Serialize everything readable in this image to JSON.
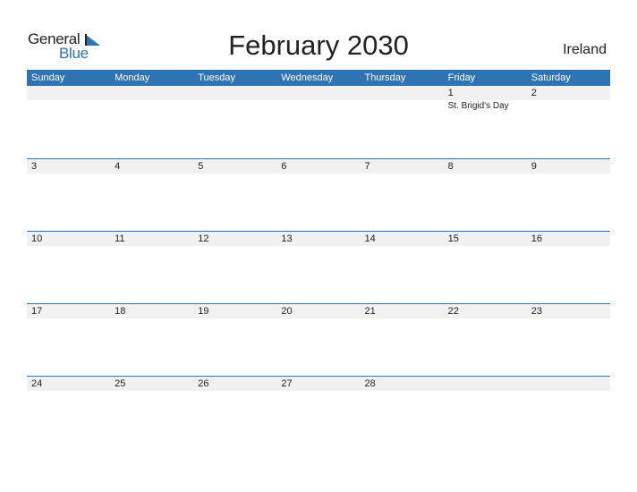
{
  "logo": {
    "line1": "General",
    "line2": "Blue"
  },
  "title": "February 2030",
  "country": "Ireland",
  "colors": {
    "accent": "#2e74b5",
    "strip": "#f1f1f1"
  },
  "weekdays": [
    "Sunday",
    "Monday",
    "Tuesday",
    "Wednesday",
    "Thursday",
    "Friday",
    "Saturday"
  ],
  "weeks": [
    [
      {
        "d": "",
        "h": ""
      },
      {
        "d": "",
        "h": ""
      },
      {
        "d": "",
        "h": ""
      },
      {
        "d": "",
        "h": ""
      },
      {
        "d": "",
        "h": ""
      },
      {
        "d": "1",
        "h": "St. Brigid's Day"
      },
      {
        "d": "2",
        "h": ""
      }
    ],
    [
      {
        "d": "3",
        "h": ""
      },
      {
        "d": "4",
        "h": ""
      },
      {
        "d": "5",
        "h": ""
      },
      {
        "d": "6",
        "h": ""
      },
      {
        "d": "7",
        "h": ""
      },
      {
        "d": "8",
        "h": ""
      },
      {
        "d": "9",
        "h": ""
      }
    ],
    [
      {
        "d": "10",
        "h": ""
      },
      {
        "d": "11",
        "h": ""
      },
      {
        "d": "12",
        "h": ""
      },
      {
        "d": "13",
        "h": ""
      },
      {
        "d": "14",
        "h": ""
      },
      {
        "d": "15",
        "h": ""
      },
      {
        "d": "16",
        "h": ""
      }
    ],
    [
      {
        "d": "17",
        "h": ""
      },
      {
        "d": "18",
        "h": ""
      },
      {
        "d": "19",
        "h": ""
      },
      {
        "d": "20",
        "h": ""
      },
      {
        "d": "21",
        "h": ""
      },
      {
        "d": "22",
        "h": ""
      },
      {
        "d": "23",
        "h": ""
      }
    ],
    [
      {
        "d": "24",
        "h": ""
      },
      {
        "d": "25",
        "h": ""
      },
      {
        "d": "26",
        "h": ""
      },
      {
        "d": "27",
        "h": ""
      },
      {
        "d": "28",
        "h": ""
      },
      {
        "d": "",
        "h": ""
      },
      {
        "d": "",
        "h": ""
      }
    ]
  ]
}
